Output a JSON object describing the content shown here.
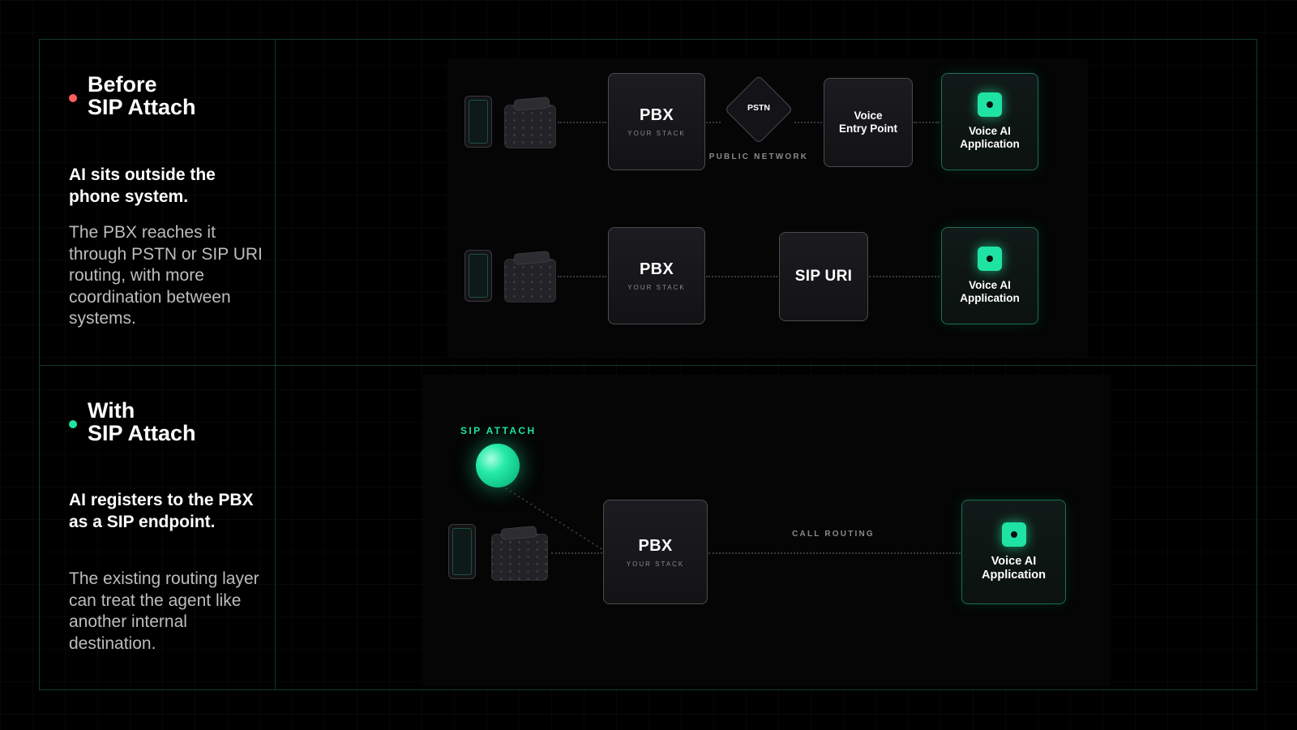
{
  "colors": {
    "accent": "#1fe3a2",
    "before_dot": "#ff5c5c",
    "after_dot": "#1fe3a2",
    "border": "#123a30"
  },
  "before": {
    "title_line1": "Before",
    "title_line2": "SIP Attach",
    "lead": "AI sits outside the phone system.",
    "description": "The PBX reaches it through PSTN or SIP URI routing, with more coordination between systems.",
    "row1": {
      "pbx_title": "PBX",
      "pbx_sub": "YOUR STACK",
      "pstn_label": "PSTN",
      "public_network": "PUBLIC NETWORK",
      "entry_point": "Voice\nEntry Point",
      "ai_app": "Voice AI\nApplication"
    },
    "row2": {
      "pbx_title": "PBX",
      "pbx_sub": "YOUR STACK",
      "sip_uri": "SIP URI",
      "ai_app": "Voice AI\nApplication"
    }
  },
  "after": {
    "title_line1": "With",
    "title_line2": "SIP Attach",
    "lead": "AI registers to the PBX as a SIP endpoint.",
    "description": "The existing routing layer can treat the agent like another internal destination.",
    "sip_attach_label": "SIP ATTACH",
    "pbx_title": "PBX",
    "pbx_sub": "YOUR STACK",
    "call_routing": "CALL ROUTING",
    "ai_app": "Voice AI\nApplication"
  }
}
